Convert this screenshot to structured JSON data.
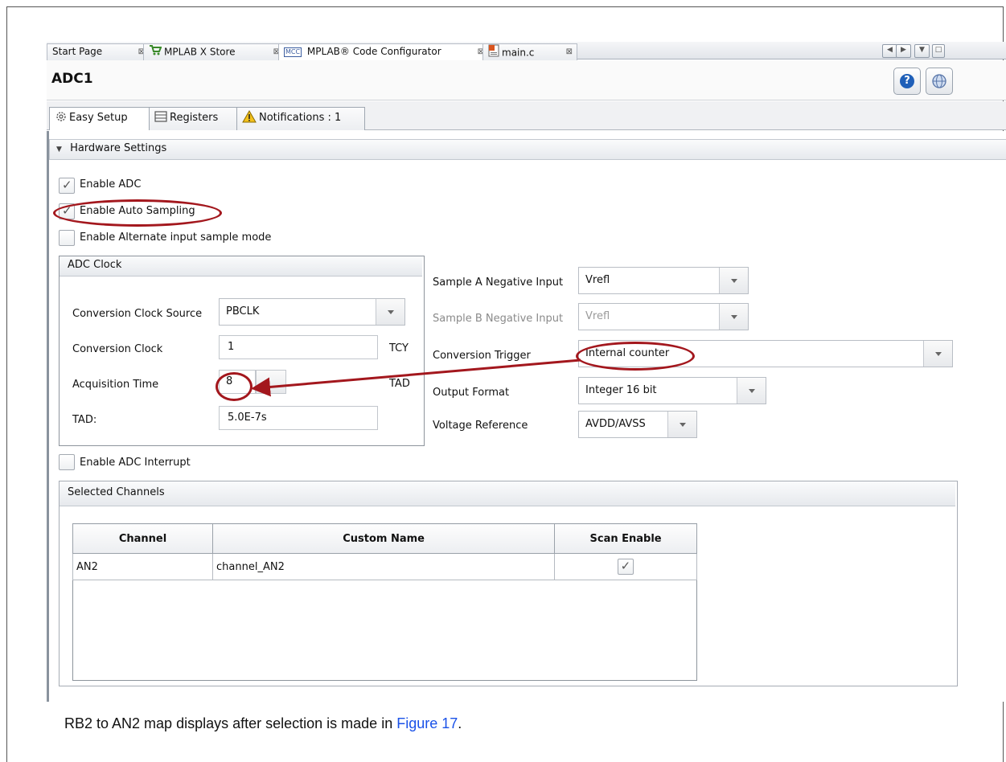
{
  "tabs": [
    {
      "label": "Start Page",
      "icon": "none",
      "close": "⊠"
    },
    {
      "label": "MPLAB X Store",
      "icon": "cart-icon",
      "close": "⊠"
    },
    {
      "label": "MPLAB® Code Configurator",
      "icon": "mcc-icon",
      "icon_text": "MCC",
      "close": "⊠"
    },
    {
      "label": "main.c",
      "icon": "c-file-icon",
      "close": "⊠"
    }
  ],
  "module": {
    "title": "ADC1"
  },
  "subtabs": [
    {
      "label": "Easy Setup",
      "icon": "gear-icon"
    },
    {
      "label": "Registers",
      "icon": "registers-icon"
    },
    {
      "label": "Notifications : 1",
      "icon": "warning-icon"
    }
  ],
  "hardware": {
    "header": "Hardware Settings",
    "enable_adc": {
      "label": "Enable ADC",
      "checked": true
    },
    "enable_auto_sampling": {
      "label": "Enable Auto Sampling",
      "checked": true
    },
    "enable_alt_input": {
      "label": "Enable Alternate input sample mode",
      "checked": false
    },
    "adc_clock": {
      "header": "ADC Clock",
      "conversion_clock_source": {
        "label": "Conversion Clock Source",
        "value": "PBCLK"
      },
      "conversion_clock": {
        "label": "Conversion Clock",
        "value": "1",
        "unit": "TCY"
      },
      "acquisition_time": {
        "label": "Acquisition Time",
        "value": "8",
        "unit": "TAD"
      },
      "tad": {
        "label": "TAD:",
        "value": "5.0E-7s"
      }
    },
    "sample_a_negative": {
      "label": "Sample A Negative Input",
      "value": "Vrefl"
    },
    "sample_b_negative": {
      "label": "Sample B Negative Input",
      "value": "Vrefl"
    },
    "conversion_trigger": {
      "label": "Conversion Trigger",
      "value": "Internal counter"
    },
    "output_format": {
      "label": "Output Format",
      "value": "Integer 16 bit"
    },
    "voltage_reference": {
      "label": "Voltage Reference",
      "value": "AVDD/AVSS"
    },
    "enable_adc_interrupt": {
      "label": "Enable ADC Interrupt",
      "checked": false
    }
  },
  "channels": {
    "header": "Selected Channels",
    "columns": [
      "Channel",
      "Custom Name",
      "Scan Enable"
    ],
    "rows": [
      {
        "channel": "AN2",
        "custom_name": "channel_AN2",
        "scan_enable": true
      }
    ]
  },
  "caption": {
    "text": "RB2 to AN2 map displays after selection is made in ",
    "link": "Figure 17",
    "end": "."
  },
  "colors": {
    "annotation": "#a3171d",
    "link": "#1a52e8",
    "help": "#1f5fb8"
  }
}
